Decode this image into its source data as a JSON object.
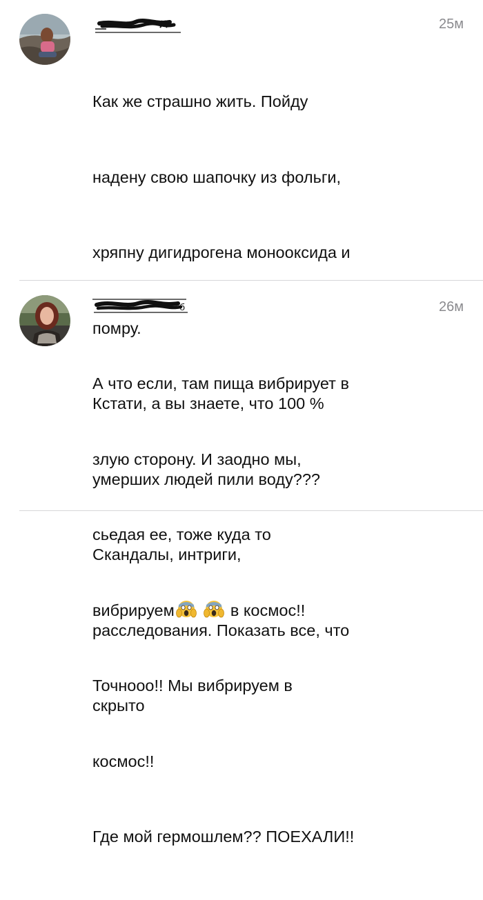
{
  "comments": [
    {
      "username": "_t______k",
      "time": "25м",
      "lines": [
        "Как же страшно жить. Пойду",
        "надену свою шапочку из фольги,",
        "хряпну дигидрогена монооксида и",
        "помру.",
        "Кстати, а вы знаете, что 100 %",
        "умерших людей пили воду???",
        "Скандалы, интриги,",
        "расследования. Показать все, что",
        "скрыто"
      ]
    },
    {
      "username": "______6",
      "time": "26м",
      "lines": [
        "А что если, там пища вибрирует в",
        "злую сторону. И заодно мы,",
        "сьедая ее, тоже куда то",
        "в космос!!",
        "Точнооо!! Мы вибрируем в",
        "космос!!",
        "Где мой гермошлем?? ПОЕХАЛИ!!"
      ],
      "emoji_line_prefix": "вибрируем",
      "emoji_icons": [
        "screaming-face-emoji",
        "screaming-face-emoji"
      ]
    }
  ],
  "colors": {
    "text": "#111111",
    "time": "#8a8a8e",
    "divider": "#d6d6d8",
    "emoji_face": "#f5c33b",
    "emoji_hands": "#f0b830",
    "emoji_scream": "#3a2a1a"
  }
}
